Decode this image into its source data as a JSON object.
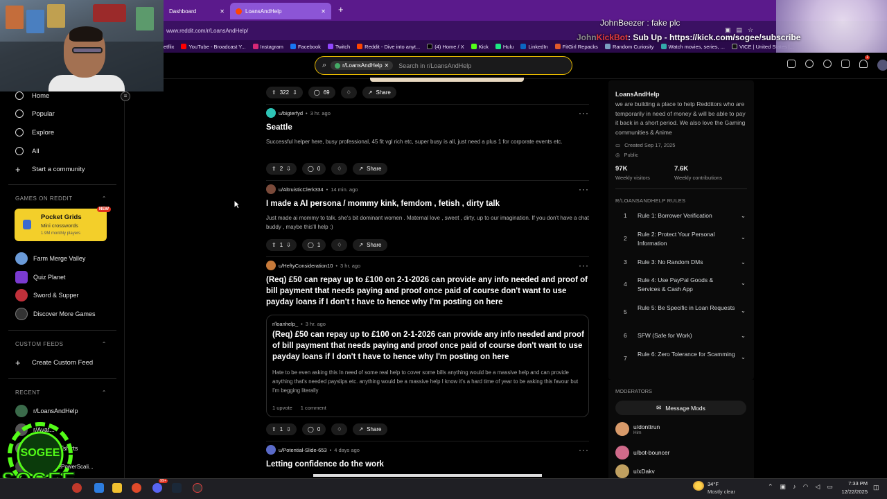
{
  "browser": {
    "tabs": [
      {
        "label": "Dashboard",
        "active": false
      },
      {
        "label": "LoansAndHelp",
        "active": true
      }
    ],
    "url": "www.reddit.com/r/LoansAndHelp/",
    "bookmarks": [
      "etflix",
      "YouTube - Broadcast Y...",
      "Instagram",
      "Facebook",
      "Twitch",
      "Reddit - Dive into anyt...",
      "(4) Home / X",
      "Kick",
      "Hulu",
      "LinkedIn",
      "FitGirl Repacks",
      "Random Curiosity",
      "Watch movies, series, ...",
      "VICE | United States |..."
    ]
  },
  "stream_overlay": {
    "line1": "JohnBeezer : fake plc",
    "line2_prefix": "John",
    "line2_brand": "KickBot",
    "line2_text": ": Sub Up - https://kick.com/sogee/subscribe",
    "logo_text_top": "SOGEE",
    "logo_text_bottom": "SOGEE"
  },
  "header": {
    "chip": "r/LoansAndHelp",
    "search_placeholder": "Search in r/LoansAndHelp",
    "notification_count": "1"
  },
  "sidebar": {
    "nav": [
      "Home",
      "Popular",
      "Explore",
      "All",
      "Start a community"
    ],
    "games_title": "GAMES ON REDDIT",
    "pocket_grids": {
      "title": "Pocket Grids",
      "subtitle": "Mini crosswords",
      "players": "1.9M monthly players",
      "badge": "NEW"
    },
    "games": [
      "Farm Merge Valley",
      "Quiz Planet",
      "Sword & Supper",
      "Discover More Games"
    ],
    "custom_feeds_title": "CUSTOM FEEDS",
    "create_feed": "Create Custom Feed",
    "recent_title": "RECENT",
    "recent": [
      "r/LoansAndHelp",
      "r/Avat...",
      "r/WorldOfTshirts",
      "r/OnePiecePowerScali..."
    ]
  },
  "top_actions": {
    "votes": "322",
    "comments": "69",
    "share": "Share"
  },
  "posts": [
    {
      "user": "u/bigterfyd",
      "time": "3 hr. ago",
      "title": "Seattle",
      "body": "Successful helper here, busy professional, 45 fit vgl rich etc, super busy is all, just need a plus 1 for corporate events etc.",
      "votes": "2",
      "comments": "0",
      "share": "Share"
    },
    {
      "user": "u/AltruisticClerk334",
      "time": "14 min. ago",
      "title": "I made a AI persona / mommy kink, femdom , fetish , dirty talk",
      "body": "Just made ai mommy to talk. she's bit dominant women . Maternal love , sweet , dirty, up to our imagination. If you don't have a chat buddy , maybe this'll help :)",
      "votes": "1",
      "comments": "1",
      "share": "Share"
    },
    {
      "user": "u/HeftyConsideration10",
      "time": "3 hr. ago",
      "title": "(Req) £50 can repay up to £100 on 2-1-2026 can provide any info needed and proof of bill payment that needs paying and proof once paid of course don't want to use payday loans if I don't t have to hence why I'm posting on here",
      "crosspost": {
        "sub": "r/loanhelp_",
        "time": "3 hr. ago",
        "title": "(Req) £50 can repay up to £100 on 2-1-2026 can provide any info needed and proof of bill payment that needs paying and proof once paid of course don't want to use payday loans if I don't t have to hence why I'm posting on here",
        "body": "Hate to be even asking this In need of some real help to cover some bills anything would be a massive help and can provide anything that's needed payslips etc. anything would be a massive help I know it's a hard time of year to be asking this favour but I'm begging literally",
        "upvotes": "1 upvote",
        "comments": "1 comment"
      },
      "votes": "1",
      "comments": "0",
      "share": "Share"
    },
    {
      "user": "u/Potential-Slide-653",
      "time": "4 days ago",
      "title": "Letting confidence do the work"
    }
  ],
  "community": {
    "name": "LoansAndHelp",
    "description": "we are building a place to help Redditors who are temporarily in need of money & will be able to pay it back in a short period. We also love the Gaming communities & Anime",
    "created": "Created Sep 17, 2025",
    "visibility": "Public",
    "visitors": "97K",
    "visitors_label": "Weekly visitors",
    "contributions": "7.6K",
    "contributions_label": "Weekly contributions",
    "rules_title": "R/LOANSANDHELP RULES",
    "rules": [
      {
        "n": "1",
        "t": "Rule 1: Borrower Verification"
      },
      {
        "n": "2",
        "t": "Rule 2: Protect Your Personal Information"
      },
      {
        "n": "3",
        "t": "Rule 3: No Random DMs"
      },
      {
        "n": "4",
        "t": "Rule 4: Use PayPal Goods & Services & Cash App"
      },
      {
        "n": "5",
        "t": "Rule 5: Be Specific in Loan Requests"
      },
      {
        "n": "6",
        "t": "SFW (Safe for Work)"
      },
      {
        "n": "7",
        "t": "Rule 6: Zero Tolerance for Scamming"
      }
    ],
    "moderators_title": "MODERATORS",
    "message_mods": "Message Mods",
    "mods": [
      {
        "name": "u/donttrun",
        "flair": "Him"
      },
      {
        "name": "u/bot-bouncer",
        "flair": ""
      },
      {
        "name": "u/xDakv",
        "flair": ""
      }
    ]
  },
  "taskbar": {
    "weather_temp": "34°F",
    "weather_desc": "Mostly clear",
    "time": "7:33 PM",
    "date": "12/22/2025",
    "badge": "99+"
  }
}
